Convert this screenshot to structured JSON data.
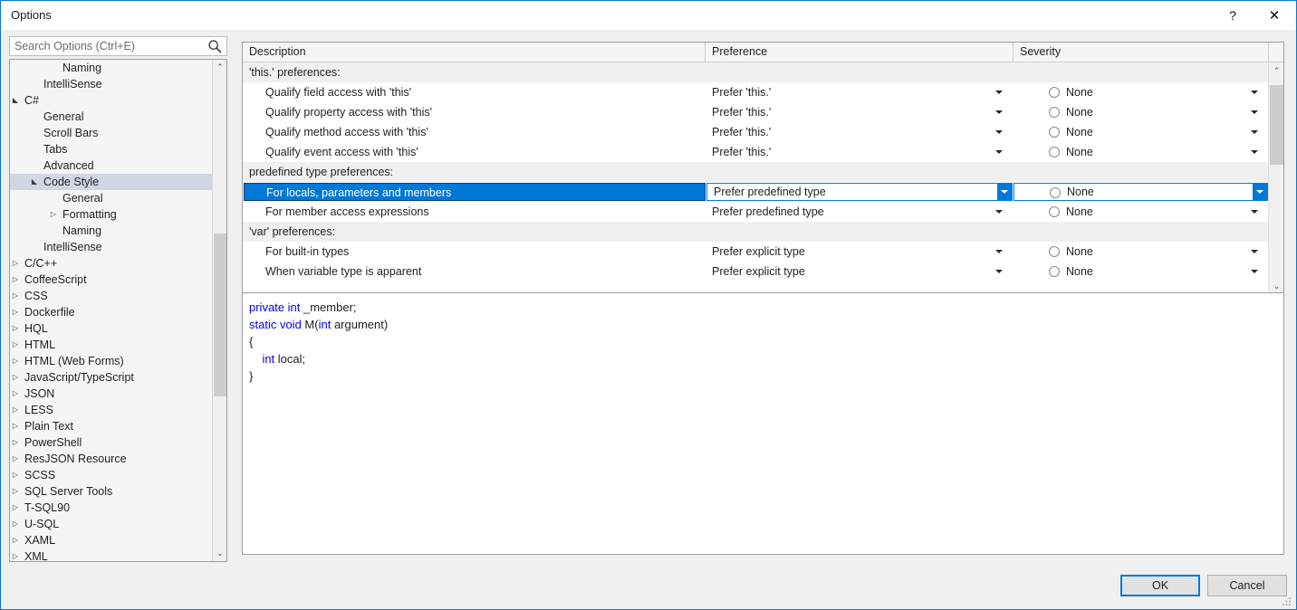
{
  "window": {
    "title": "Options",
    "help_label": "?",
    "close_label": "✕"
  },
  "search": {
    "placeholder": "Search Options (Ctrl+E)",
    "value": "",
    "icon": "search-icon"
  },
  "tree": {
    "nodes": [
      {
        "label": "Naming",
        "depth": 3,
        "expander": "",
        "selected": false
      },
      {
        "label": "IntelliSense",
        "depth": 2,
        "expander": "",
        "selected": false
      },
      {
        "label": "C#",
        "depth": 1,
        "expander": "▲",
        "selected": false
      },
      {
        "label": "General",
        "depth": 2,
        "expander": "",
        "selected": false
      },
      {
        "label": "Scroll Bars",
        "depth": 2,
        "expander": "",
        "selected": false
      },
      {
        "label": "Tabs",
        "depth": 2,
        "expander": "",
        "selected": false
      },
      {
        "label": "Advanced",
        "depth": 2,
        "expander": "",
        "selected": false
      },
      {
        "label": "Code Style",
        "depth": 2,
        "expander": "▲",
        "selected": true
      },
      {
        "label": "General",
        "depth": 3,
        "expander": "",
        "selected": false
      },
      {
        "label": "Formatting",
        "depth": 3,
        "expander": "▶",
        "selected": false
      },
      {
        "label": "Naming",
        "depth": 3,
        "expander": "",
        "selected": false
      },
      {
        "label": "IntelliSense",
        "depth": 2,
        "expander": "",
        "selected": false
      },
      {
        "label": "C/C++",
        "depth": 1,
        "expander": "▶",
        "selected": false
      },
      {
        "label": "CoffeeScript",
        "depth": 1,
        "expander": "▶",
        "selected": false
      },
      {
        "label": "CSS",
        "depth": 1,
        "expander": "▶",
        "selected": false
      },
      {
        "label": "Dockerfile",
        "depth": 1,
        "expander": "▶",
        "selected": false
      },
      {
        "label": "HQL",
        "depth": 1,
        "expander": "▶",
        "selected": false
      },
      {
        "label": "HTML",
        "depth": 1,
        "expander": "▶",
        "selected": false
      },
      {
        "label": "HTML (Web Forms)",
        "depth": 1,
        "expander": "▶",
        "selected": false
      },
      {
        "label": "JavaScript/TypeScript",
        "depth": 1,
        "expander": "▶",
        "selected": false
      },
      {
        "label": "JSON",
        "depth": 1,
        "expander": "▶",
        "selected": false
      },
      {
        "label": "LESS",
        "depth": 1,
        "expander": "▶",
        "selected": false
      },
      {
        "label": "Plain Text",
        "depth": 1,
        "expander": "▶",
        "selected": false
      },
      {
        "label": "PowerShell",
        "depth": 1,
        "expander": "▶",
        "selected": false
      },
      {
        "label": "ResJSON Resource",
        "depth": 1,
        "expander": "▶",
        "selected": false
      },
      {
        "label": "SCSS",
        "depth": 1,
        "expander": "▶",
        "selected": false
      },
      {
        "label": "SQL Server Tools",
        "depth": 1,
        "expander": "▶",
        "selected": false
      },
      {
        "label": "T-SQL90",
        "depth": 1,
        "expander": "▶",
        "selected": false
      },
      {
        "label": "U-SQL",
        "depth": 1,
        "expander": "▶",
        "selected": false
      },
      {
        "label": "XAML",
        "depth": 1,
        "expander": "▶",
        "selected": false
      },
      {
        "label": "XML",
        "depth": 1,
        "expander": "▶",
        "selected": false
      }
    ],
    "scroll_up_icon": "chevron-up-icon",
    "scroll_down_icon": "chevron-down-icon"
  },
  "grid": {
    "columns": [
      {
        "label": "Description"
      },
      {
        "label": "Preference"
      },
      {
        "label": "Severity"
      }
    ],
    "rows": [
      {
        "type": "group",
        "description": "'this.' preferences:"
      },
      {
        "type": "item",
        "description": "Qualify field access with 'this'",
        "preference": "Prefer 'this.'",
        "severity": "None",
        "selected": false
      },
      {
        "type": "item",
        "description": "Qualify property access with 'this'",
        "preference": "Prefer 'this.'",
        "severity": "None",
        "selected": false
      },
      {
        "type": "item",
        "description": "Qualify method access with 'this'",
        "preference": "Prefer 'this.'",
        "severity": "None",
        "selected": false
      },
      {
        "type": "item",
        "description": "Qualify event access with 'this'",
        "preference": "Prefer 'this.'",
        "severity": "None",
        "selected": false
      },
      {
        "type": "group",
        "description": "predefined type preferences:"
      },
      {
        "type": "item",
        "description": "For locals, parameters and members",
        "preference": "Prefer predefined type",
        "severity": "None",
        "selected": true
      },
      {
        "type": "item",
        "description": "For member access expressions",
        "preference": "Prefer predefined type",
        "severity": "None",
        "selected": false
      },
      {
        "type": "group",
        "description": "'var' preferences:"
      },
      {
        "type": "item",
        "description": "For built-in types",
        "preference": "Prefer explicit type",
        "severity": "None",
        "selected": false
      },
      {
        "type": "item",
        "description": "When variable type is apparent",
        "preference": "Prefer explicit type",
        "severity": "None",
        "selected": false
      }
    ],
    "scroll_up_icon": "chevron-up-icon",
    "scroll_down_icon": "chevron-down-icon"
  },
  "preview": {
    "lines": [
      [
        {
          "t": "private int ",
          "kw": true
        },
        {
          "t": "_member;",
          "kw": false
        }
      ],
      [
        {
          "t": "static void ",
          "kw": true
        },
        {
          "t": "M(",
          "kw": false
        },
        {
          "t": "int ",
          "kw": true
        },
        {
          "t": "argument)",
          "kw": false
        }
      ],
      [
        {
          "t": "{",
          "kw": false
        }
      ],
      [
        {
          "t": "    int ",
          "kw": true
        },
        {
          "t": "local;",
          "kw": false
        }
      ],
      [
        {
          "t": "}",
          "kw": false
        }
      ]
    ]
  },
  "footer": {
    "ok_label": "OK",
    "cancel_label": "Cancel"
  },
  "colors": {
    "accent": "#0078d7",
    "selection_border": "#00407a",
    "tree_selection": "#cfd6e6",
    "keyword": "#0000ff",
    "dialog_bg": "#f0f0f0"
  }
}
